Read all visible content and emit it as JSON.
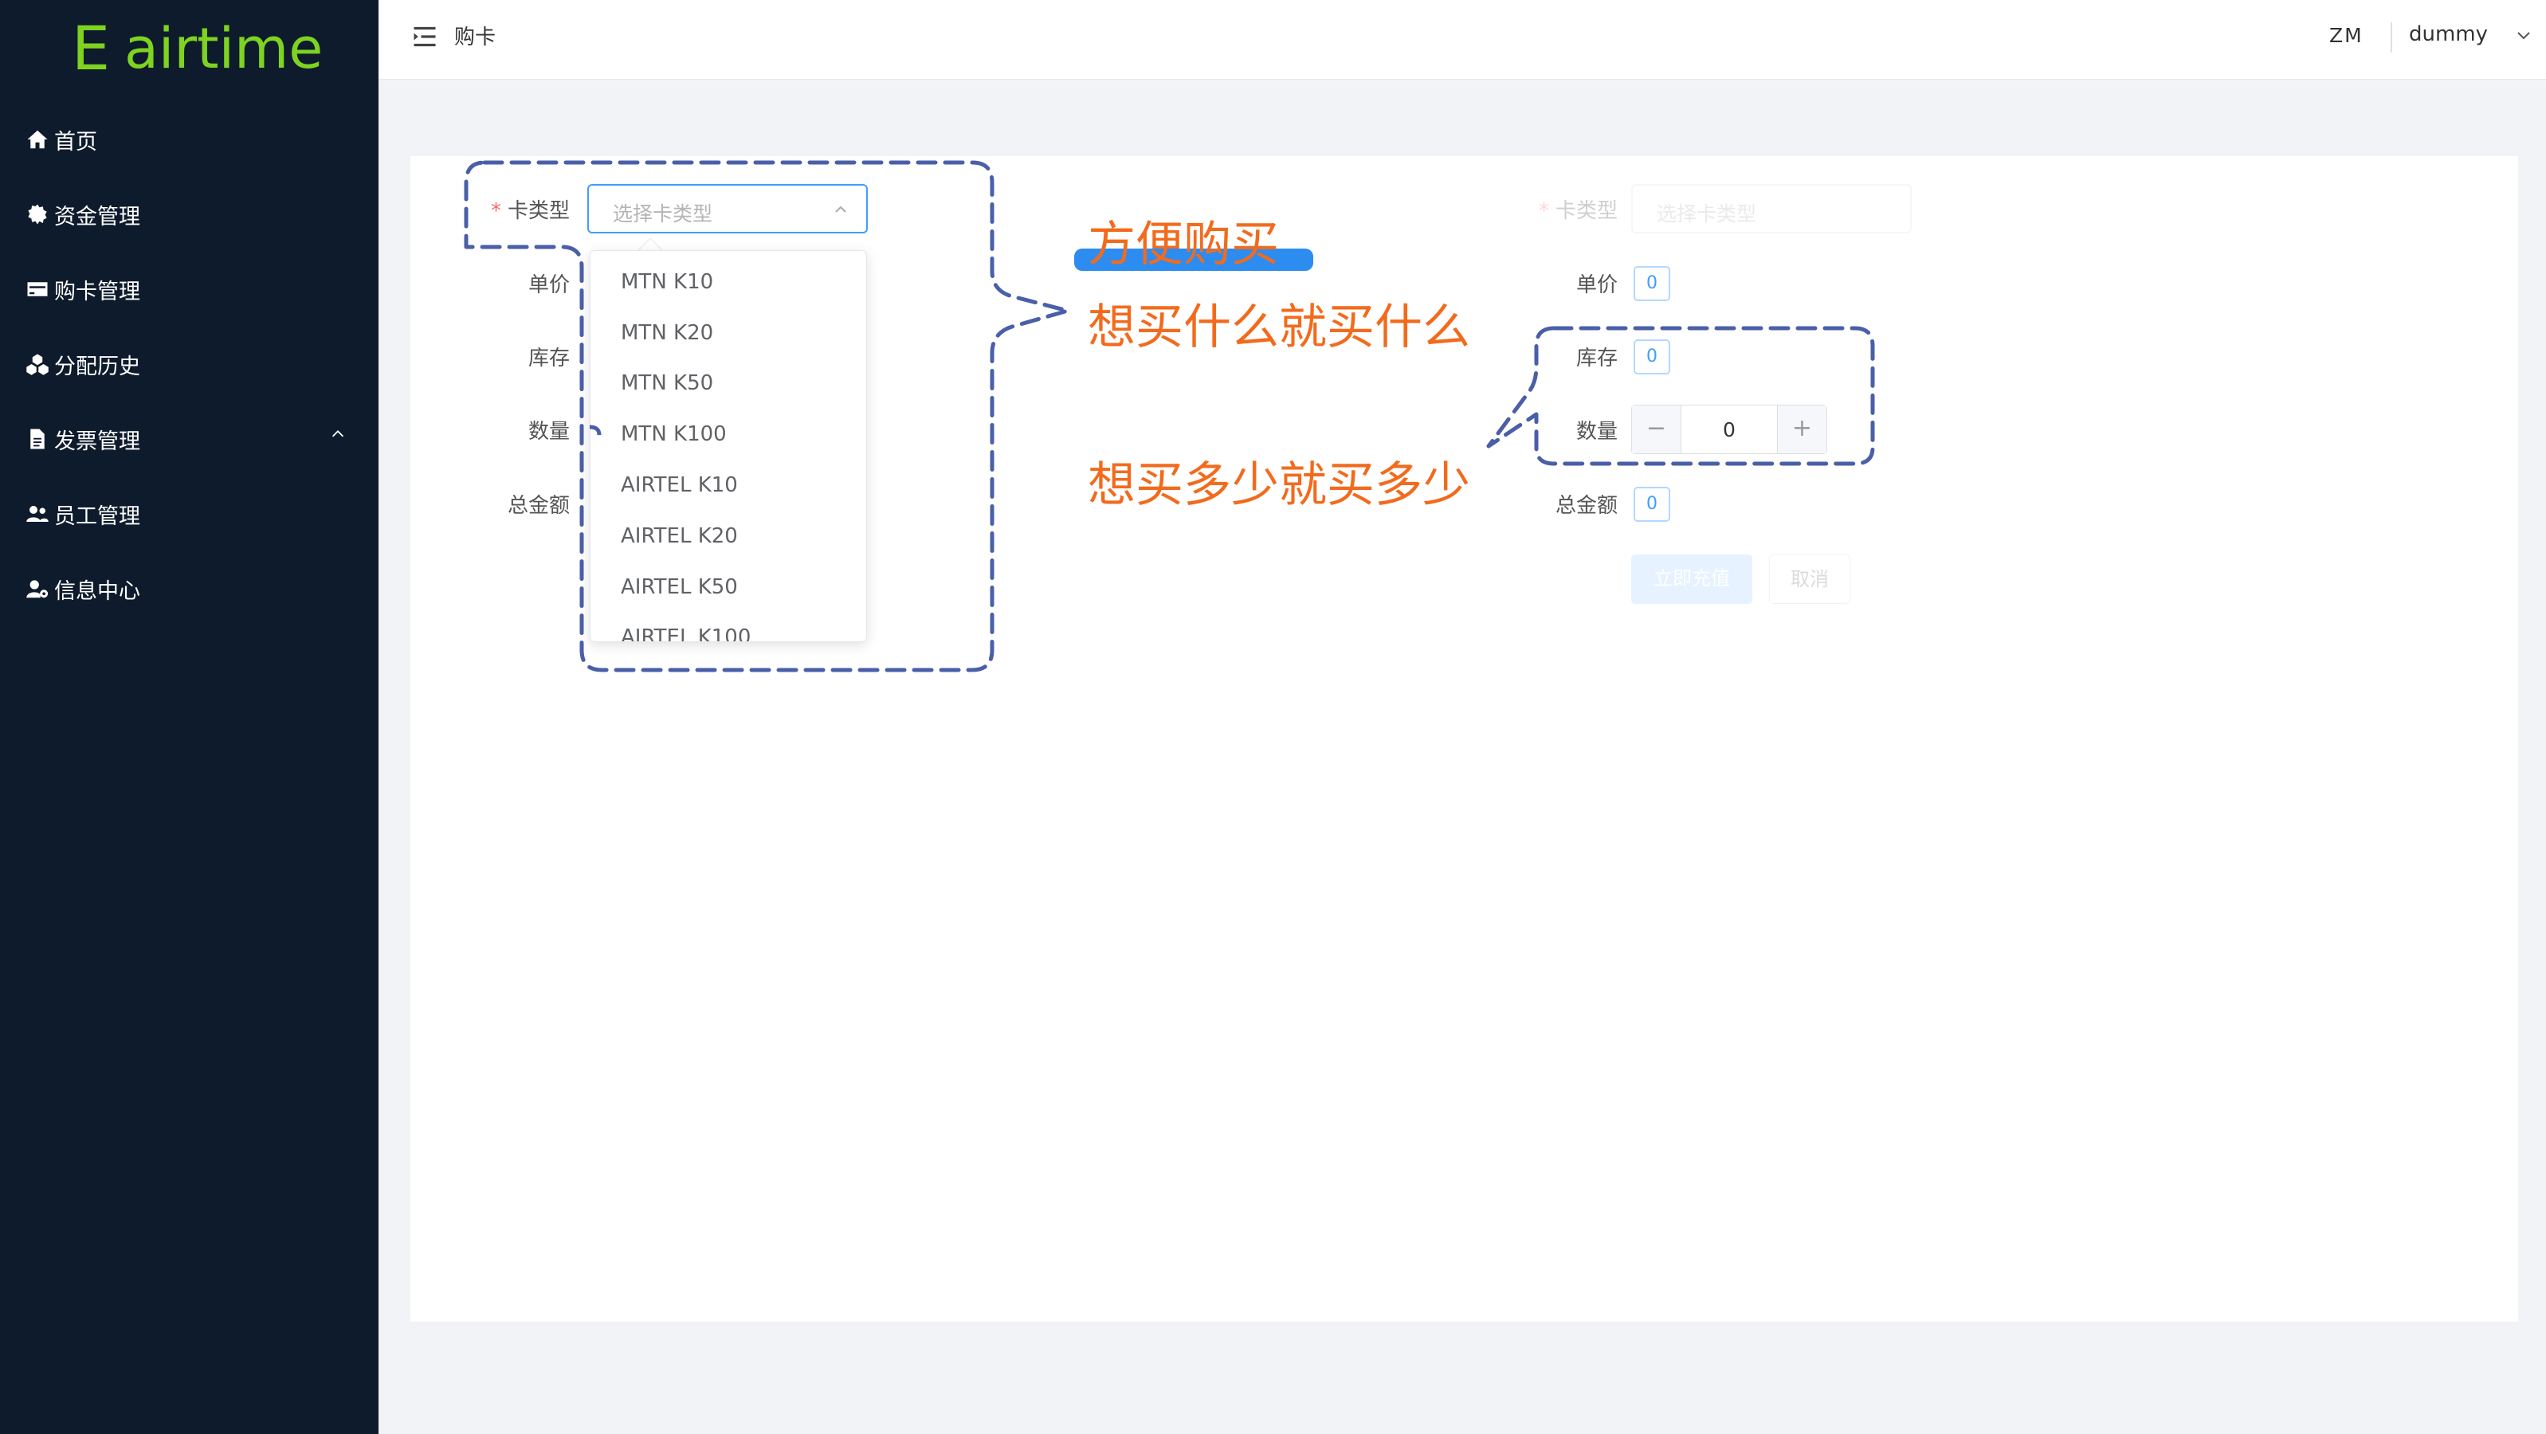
{
  "logo": {
    "mark": "E",
    "text": "airtime"
  },
  "sidebar": {
    "items": [
      {
        "label": "首页",
        "icon": "home-icon"
      },
      {
        "label": "资金管理",
        "icon": "gear-icon"
      },
      {
        "label": "购卡管理",
        "icon": "credit-card-icon"
      },
      {
        "label": "分配历史",
        "icon": "cubes-icon"
      },
      {
        "label": "发票管理",
        "icon": "file-icon"
      },
      {
        "label": "员工管理",
        "icon": "users-icon"
      },
      {
        "label": "信息中心",
        "icon": "user-gear-icon"
      }
    ]
  },
  "header": {
    "title": "购卡",
    "initials": "ZM",
    "username": "dummy"
  },
  "form": {
    "card_type_label": "卡类型",
    "card_type_placeholder": "选择卡类型",
    "unit_price_label": "单价",
    "stock_label": "库存",
    "quantity_label": "数量",
    "total_label": "总金额"
  },
  "dropdown": {
    "options": [
      "MTN K10",
      "MTN K20",
      "MTN K50",
      "MTN K100",
      "AIRTEL K10",
      "AIRTEL K20",
      "AIRTEL K50",
      "AIRTEL K100"
    ]
  },
  "form_right": {
    "card_type_label": "卡类型",
    "card_type_placeholder": "选择卡类型",
    "unit_price_label": "单价",
    "unit_price_value": "0",
    "stock_label": "库存",
    "stock_value": "0",
    "quantity_label": "数量",
    "quantity_value": "0",
    "total_label": "总金额",
    "total_value": "0",
    "submit_label": "立即充值",
    "cancel_label": "取消"
  },
  "annotations": {
    "title": "方便购买",
    "line1": "想买什么就买什么",
    "line2": "想买多少就买多少"
  },
  "colors": {
    "sidebar_bg": "#0e1b2c",
    "logo_green": "#7ed321",
    "annotation_orange": "#f26b1d",
    "annotation_dash": "#4a5fa8",
    "primary_blue": "#409eff"
  }
}
